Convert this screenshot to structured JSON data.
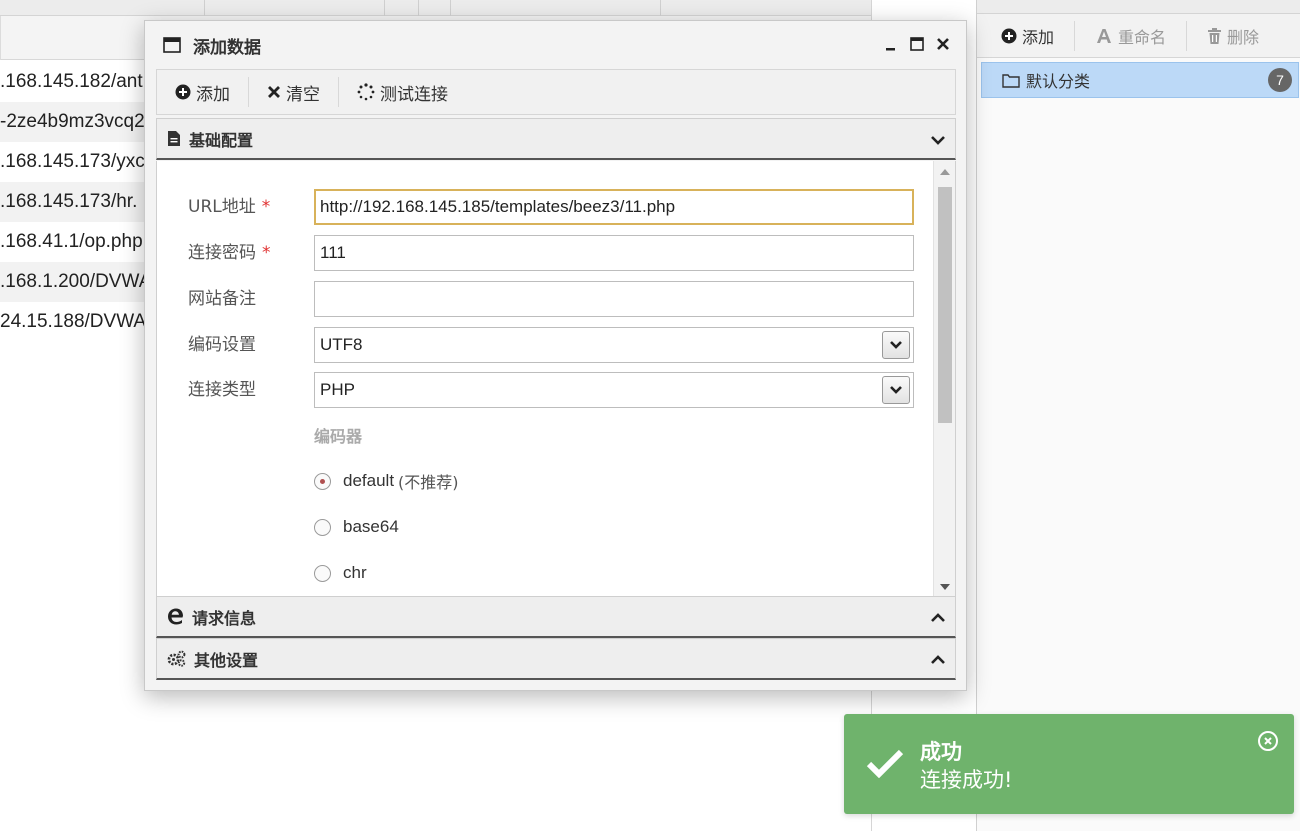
{
  "background_list": {
    "rows": [
      ".168.145.182/ant",
      "-2ze4b9mz3vcq2",
      ".168.145.173/yxc",
      ".168.145.173/hr.",
      ".168.41.1/op.php",
      ".168.1.200/DVWA",
      "24.15.188/DVWA"
    ]
  },
  "category_panel": {
    "toolbar": {
      "add_label": "添加",
      "rename_label": "重命名",
      "delete_label": "删除"
    },
    "items": [
      {
        "label": "默认分类",
        "count": "7"
      }
    ]
  },
  "dialog": {
    "title": "添加数据",
    "toolbar": {
      "add_label": "添加",
      "clear_label": "清空",
      "test_label": "测试连接"
    },
    "sections": {
      "basic": "基础配置",
      "request": "请求信息",
      "other": "其他设置"
    },
    "form": {
      "url_label": "URL地址",
      "url_value": "http://192.168.145.185/templates/beez3/11.php",
      "password_label": "连接密码",
      "password_value": "111",
      "note_label": "网站备注",
      "note_value": "",
      "encoding_label": "编码设置",
      "encoding_value": "UTF8",
      "type_label": "连接类型",
      "type_value": "PHP",
      "required_mark": "*",
      "encoder_title": "编码器",
      "encoders": [
        {
          "label": "default",
          "hint": "(不推荐)",
          "selected": true
        },
        {
          "label": "base64",
          "hint": "",
          "selected": false
        },
        {
          "label": "chr",
          "hint": "",
          "selected": false
        }
      ]
    }
  },
  "toast": {
    "title": "成功",
    "message": "连接成功!",
    "color": "#6fb36c"
  },
  "colors": {
    "selected_category": "#bcd9f7",
    "focus_border": "#d8b25a",
    "required": "#e03030"
  }
}
